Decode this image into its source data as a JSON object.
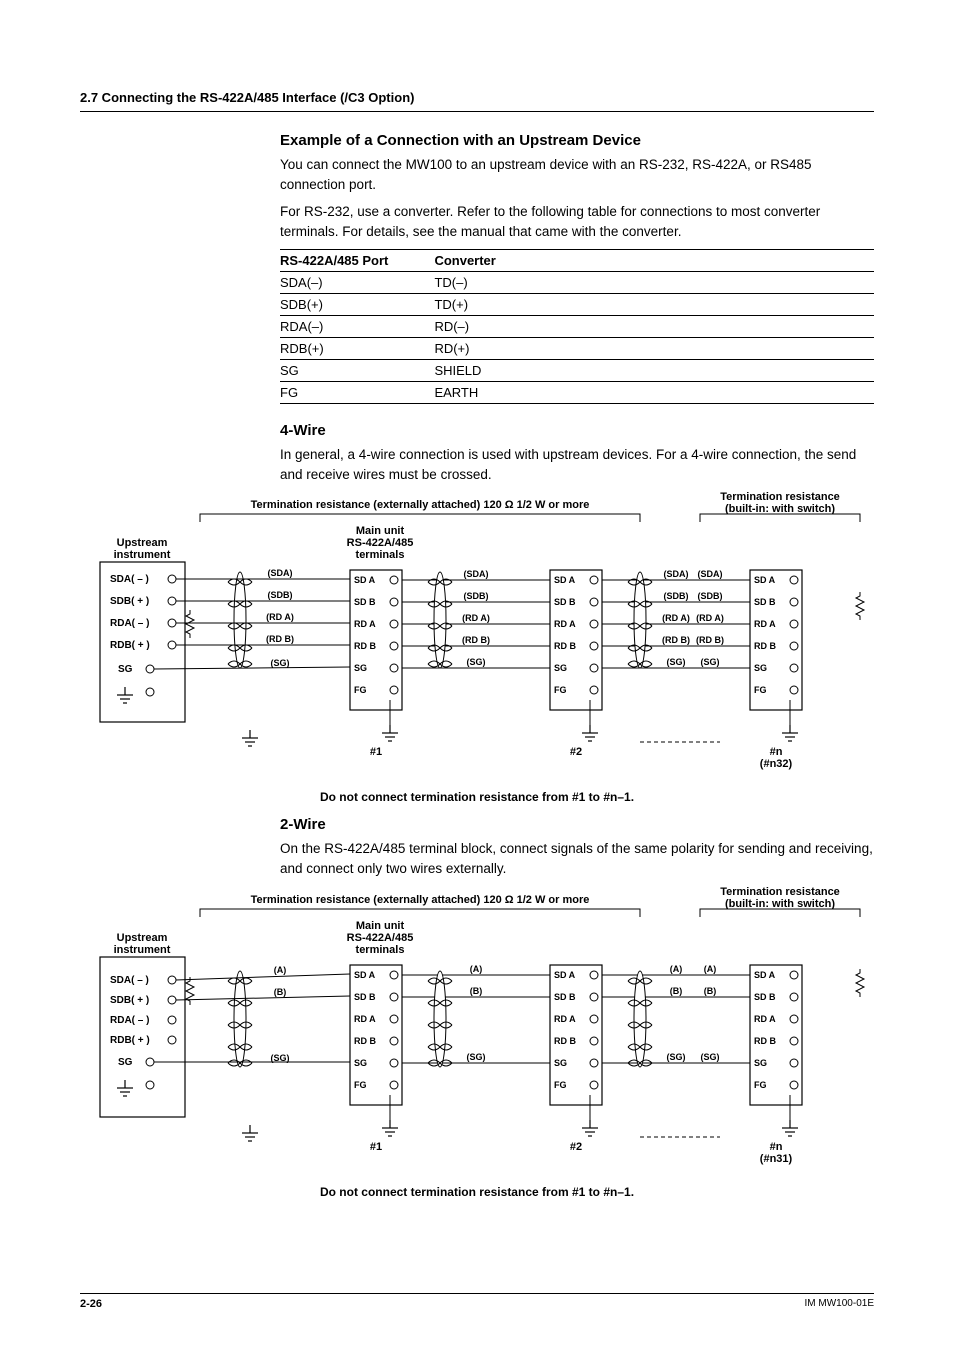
{
  "section_header": "2.7  Connecting the RS-422A/485 Interface (/C3 Option)",
  "example": {
    "heading": "Example of a Connection with an Upstream Device",
    "p1": "You can connect the MW100 to an upstream device with an RS-232, RS-422A, or RS485 connection port.",
    "p2": "For RS-232, use a converter. Refer to the following table for connections to most converter terminals. For details, see the manual that came with the converter."
  },
  "table": {
    "headers": [
      "RS-422A/485 Port",
      "Converter"
    ],
    "rows": [
      [
        "SDA(–)",
        "TD(–)"
      ],
      [
        "SDB(+)",
        "TD(+)"
      ],
      [
        "RDA(–)",
        "RD(–)"
      ],
      [
        "RDB(+)",
        "RD(+)"
      ],
      [
        "SG",
        "SHIELD"
      ],
      [
        "FG",
        "EARTH"
      ]
    ]
  },
  "four_wire": {
    "heading": "4-Wire",
    "p1": "In general, a 4-wire connection is used with upstream devices. For a 4-wire connection, the send and receive wires must be crossed."
  },
  "two_wire": {
    "heading": "2-Wire",
    "p1": "On the RS-422A/485 terminal block, connect signals of the same polarity for sending and receiving, and connect only two wires externally."
  },
  "diagram": {
    "term_res_ext": "Termination resistance (externally attached) 120 Ω 1/2 W or more",
    "term_res_int": "Termination resistance\n(built-in: with switch)",
    "upstream": "Upstream\ninstrument",
    "main_unit": "Main unit\nRS-422A/485\nterminals",
    "sda_minus": "SDA( – )",
    "sdb_plus": "SDB( + )",
    "rda_minus": "RDA( – )",
    "rdb_plus": "RDB( + )",
    "sg": "SG",
    "sda_sig": "(SDA)",
    "sdb_sig": "(SDB)",
    "rda_sig": "(RD A)",
    "rdb_sig": "(RD B)",
    "sg_sig": "(SG)",
    "a_sig": "(A)",
    "b_sig": "(B)",
    "SD_A": "SD A",
    "SD_B": "SD B",
    "RD_A": "RD A",
    "RD_B": "RD B",
    "SG_t": "SG",
    "FG_t": "FG",
    "n1": "#1",
    "n2": "#2",
    "nn4": "#n\n(#n32)",
    "nn2": "#n\n(#n31)",
    "note4": "Do not connect termination resistance from #1 to #n–1.",
    "note2": "Do not connect termination resistance from #1 to #n–1."
  },
  "footer": {
    "page": "2-26",
    "doc": "IM MW100-01E"
  }
}
